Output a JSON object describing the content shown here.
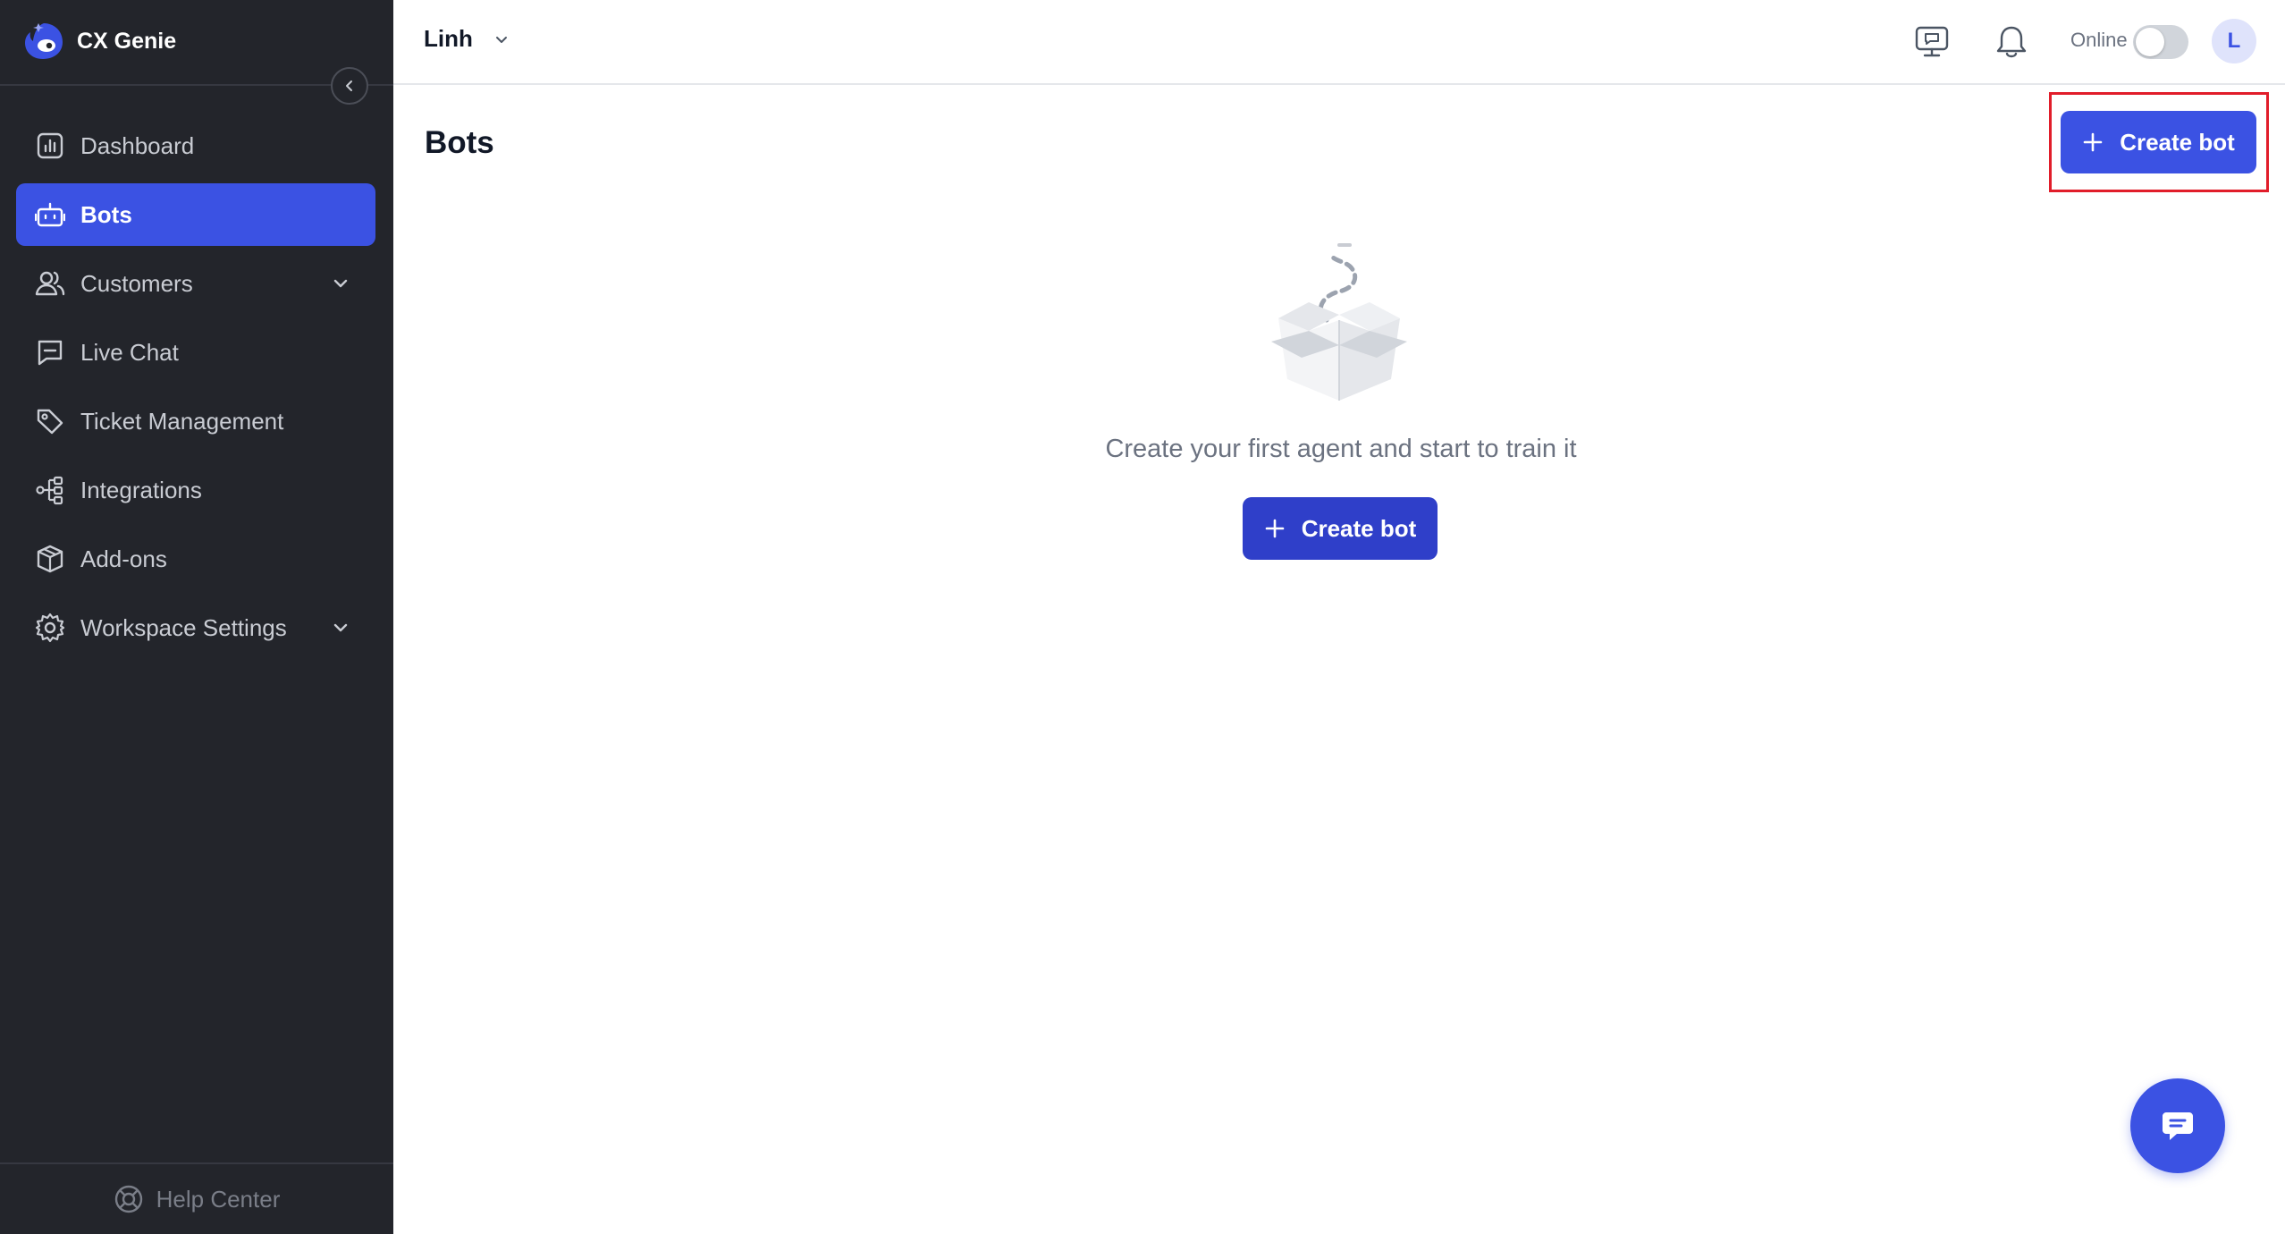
{
  "brand": {
    "name": "CX Genie",
    "logo_icon": "genie-logo-icon",
    "accent": "#3b52e3"
  },
  "sidebar": {
    "collapse_icon": "chevron-left-icon",
    "items": [
      {
        "label": "Dashboard",
        "icon": "chart-bars-icon",
        "active": false,
        "expandable": false
      },
      {
        "label": "Bots",
        "icon": "robot-icon",
        "active": true,
        "expandable": false
      },
      {
        "label": "Customers",
        "icon": "users-icon",
        "active": false,
        "expandable": true
      },
      {
        "label": "Live Chat",
        "icon": "chat-bubble-icon",
        "active": false,
        "expandable": false
      },
      {
        "label": "Ticket Management",
        "icon": "tag-icon",
        "active": false,
        "expandable": false
      },
      {
        "label": "Integrations",
        "icon": "nodes-icon",
        "active": false,
        "expandable": false
      },
      {
        "label": "Add-ons",
        "icon": "package-icon",
        "active": false,
        "expandable": false
      },
      {
        "label": "Workspace Settings",
        "icon": "gear-icon",
        "active": false,
        "expandable": true
      }
    ],
    "help_center": {
      "label": "Help Center",
      "icon": "lifebuoy-icon"
    }
  },
  "header": {
    "workspace_name": "Linh",
    "online_label": "Online",
    "online_toggle_on": false,
    "avatar_initial": "L"
  },
  "main": {
    "title": "Bots",
    "create_button_label": "Create bot",
    "empty_state": {
      "message": "Create your first agent and start to train it",
      "button_label": "Create bot",
      "illustration": "empty-box-illustration"
    }
  },
  "colors": {
    "sidebar_bg": "#23252b",
    "active_item": "#3b52e3",
    "highlight_border": "#e11d2a"
  }
}
